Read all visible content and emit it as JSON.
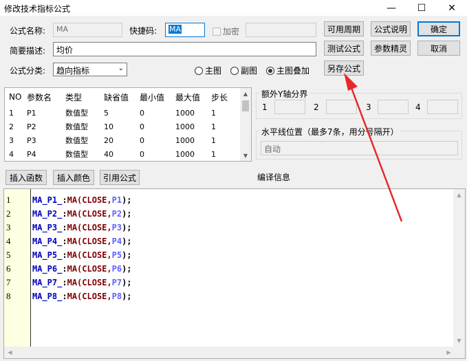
{
  "window": {
    "title": "修改技术指标公式",
    "minimize": "—",
    "maximize": "☐",
    "close": "✕"
  },
  "form": {
    "name_label": "公式名称:",
    "name_value": "MA",
    "shortcut_label": "快捷码:",
    "shortcut_value": "MA",
    "encrypt_label": "加密",
    "encrypt_checked": false,
    "desc_label": "简要描述:",
    "desc_value": "均价",
    "category_label": "公式分类:",
    "category_value": "趋向指标",
    "display_options": [
      {
        "label": "主图",
        "selected": false
      },
      {
        "label": "副图",
        "selected": false
      },
      {
        "label": "主图叠加",
        "selected": true
      }
    ]
  },
  "buttons": {
    "available_period": "可用周期",
    "formula_help": "公式说明",
    "ok": "确定",
    "test_formula": "测试公式",
    "param_wizard": "参数精灵",
    "cancel": "取消",
    "save_as": "另存公式",
    "insert_function": "插入函数",
    "insert_color": "插入颜色",
    "reference_formula": "引用公式"
  },
  "params_table": {
    "headers": [
      "NO",
      "参数名",
      "类型",
      "缺省值",
      "最小值",
      "最大值",
      "步长"
    ],
    "rows": [
      [
        "1",
        "P1",
        "数值型",
        "5",
        "0",
        "1000",
        "1"
      ],
      [
        "2",
        "P2",
        "数值型",
        "10",
        "0",
        "1000",
        "1"
      ],
      [
        "3",
        "P3",
        "数值型",
        "20",
        "0",
        "1000",
        "1"
      ],
      [
        "4",
        "P4",
        "数值型",
        "40",
        "0",
        "1000",
        "1"
      ]
    ]
  },
  "extra_y": {
    "title": "额外Y轴分界",
    "labels": [
      "1",
      "2",
      "3",
      "4"
    ],
    "values": [
      "",
      "",
      "",
      ""
    ]
  },
  "hlines": {
    "title": "水平线位置（最多7条，用分号隔开）",
    "value": "自动"
  },
  "compile_info_label": "编译信息",
  "editor": {
    "line_numbers": [
      "1",
      "2",
      "3",
      "4",
      "5",
      "6",
      "7",
      "8"
    ],
    "lines": [
      {
        "var": "MA_P1_",
        "op": ":",
        "fn": "MA(CLOSE,",
        "param": "P1",
        "end": ");"
      },
      {
        "var": "MA_P2_",
        "op": ":",
        "fn": "MA(CLOSE,",
        "param": "P2",
        "end": ");"
      },
      {
        "var": "MA_P3_",
        "op": ":",
        "fn": "MA(CLOSE,",
        "param": "P3",
        "end": ");"
      },
      {
        "var": "MA_P4_",
        "op": ":",
        "fn": "MA(CLOSE,",
        "param": "P4",
        "end": ");"
      },
      {
        "var": "MA_P5_",
        "op": ":",
        "fn": "MA(CLOSE,",
        "param": "P5",
        "end": ");"
      },
      {
        "var": "MA_P6_",
        "op": ":",
        "fn": "MA(CLOSE,",
        "param": "P6",
        "end": ");"
      },
      {
        "var": "MA_P7_",
        "op": ":",
        "fn": "MA(CLOSE,",
        "param": "P7",
        "end": ");"
      },
      {
        "var": "MA_P8_",
        "op": ":",
        "fn": "MA(CLOSE,",
        "param": "P8",
        "end": ");"
      }
    ]
  },
  "colors": {
    "annotation_arrow": "#e8292b",
    "code_var": "#0000c0",
    "code_fn": "#800000",
    "code_param": "#6060ff",
    "gutter_bg": "#ffffe1"
  }
}
